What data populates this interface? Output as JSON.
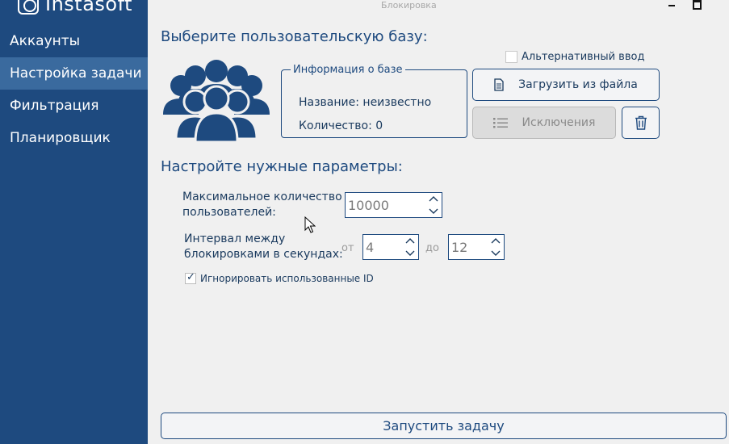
{
  "window": {
    "title": "Блокировка"
  },
  "sidebar": {
    "logo_text": "Instasoft",
    "items": [
      {
        "label": "Аккаунты",
        "active": false
      },
      {
        "label": "Настройка задачи",
        "active": true
      },
      {
        "label": "Фильтрация",
        "active": false
      },
      {
        "label": "Планировщик",
        "active": false
      }
    ]
  },
  "base": {
    "heading": "Выберите пользовательскую базу:",
    "group_icon": "users-group-icon",
    "info": {
      "legend": "Информация о базе",
      "name_line": "Название: неизвестно",
      "count_line": "Количество: 0"
    },
    "alt_input_label": "Альтернативный ввод",
    "alt_input_checked": false,
    "load_button": "Загрузить из файла",
    "exclusions_button": "Исключения",
    "delete_icon": "trash-icon"
  },
  "params": {
    "heading": "Настройте нужные параметры:",
    "max_users_label_1": "Максимальное количество",
    "max_users_label_2": "пользователей:",
    "max_users_value": "10000",
    "interval_label_1": "Интервал между",
    "interval_label_2": "блокировками в секундах:",
    "from_label": "от",
    "from_value": "4",
    "to_label": "до",
    "to_value": "12",
    "ignore_label": "Игнорировать использованные ID",
    "ignore_checked": true
  },
  "footer": {
    "start_button": "Запустить задачу"
  },
  "colors": {
    "sidebar": "#1e4a7f",
    "sidebar_active": "#3a6a9e",
    "accent": "#1e4a7f",
    "background": "#f0f0f0"
  }
}
